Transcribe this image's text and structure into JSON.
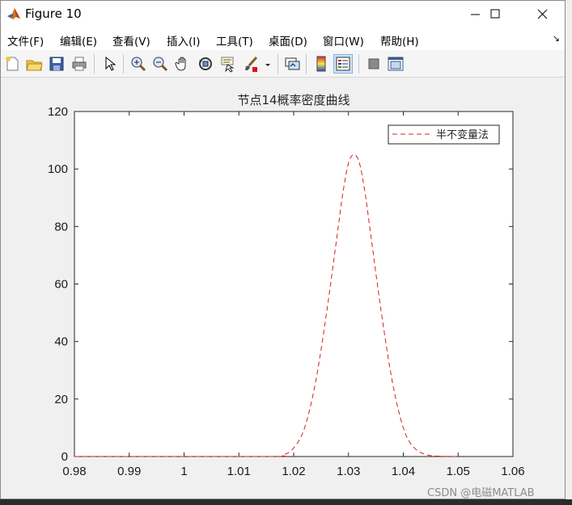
{
  "window": {
    "title": "Figure 10",
    "icon": "matlab-logo-icon"
  },
  "menubar": {
    "items": [
      {
        "label": "文件(F)"
      },
      {
        "label": "编辑(E)"
      },
      {
        "label": "查看(V)"
      },
      {
        "label": "插入(I)"
      },
      {
        "label": "工具(T)"
      },
      {
        "label": "桌面(D)"
      },
      {
        "label": "窗口(W)"
      },
      {
        "label": "帮助(H)"
      }
    ]
  },
  "toolbar": {
    "buttons": [
      "new-figure-icon",
      "open-folder-icon",
      "save-icon",
      "print-icon",
      "pointer-icon",
      "zoom-in-icon",
      "zoom-out-icon",
      "pan-hand-icon",
      "rotate-3d-icon",
      "data-cursor-icon",
      "brush-icon",
      "link-plot-icon",
      "colorbar-icon",
      "legend-icon",
      "hide-plot-tools-icon",
      "show-plot-tools-icon"
    ]
  },
  "chart_data": {
    "type": "line",
    "title": "节点14概率密度曲线",
    "xlabel": "",
    "ylabel": "",
    "xlim": [
      0.98,
      1.06
    ],
    "ylim": [
      0,
      120
    ],
    "xticks": [
      "0.98",
      "0.99",
      "1",
      "1.01",
      "1.02",
      "1.03",
      "1.04",
      "1.05",
      "1.06"
    ],
    "yticks": [
      "0",
      "20",
      "40",
      "60",
      "80",
      "100",
      "120"
    ],
    "legend_position": "top-right",
    "grid": false,
    "series": [
      {
        "name": "半不变量法",
        "color": "#d62020",
        "style": "dashed",
        "x": [
          0.98,
          1.015,
          1.018,
          1.02,
          1.022,
          1.024,
          1.026,
          1.028,
          1.029,
          1.03,
          1.031,
          1.032,
          1.033,
          1.034,
          1.036,
          1.038,
          1.04,
          1.042,
          1.045,
          1.05
        ],
        "y": [
          0,
          0,
          0.5,
          3,
          10,
          26,
          50,
          78,
          92,
          102,
          105,
          102,
          92,
          78,
          50,
          26,
          10,
          3,
          0.3,
          0
        ]
      }
    ]
  },
  "watermark": "CSDN @电磁MATLAB"
}
